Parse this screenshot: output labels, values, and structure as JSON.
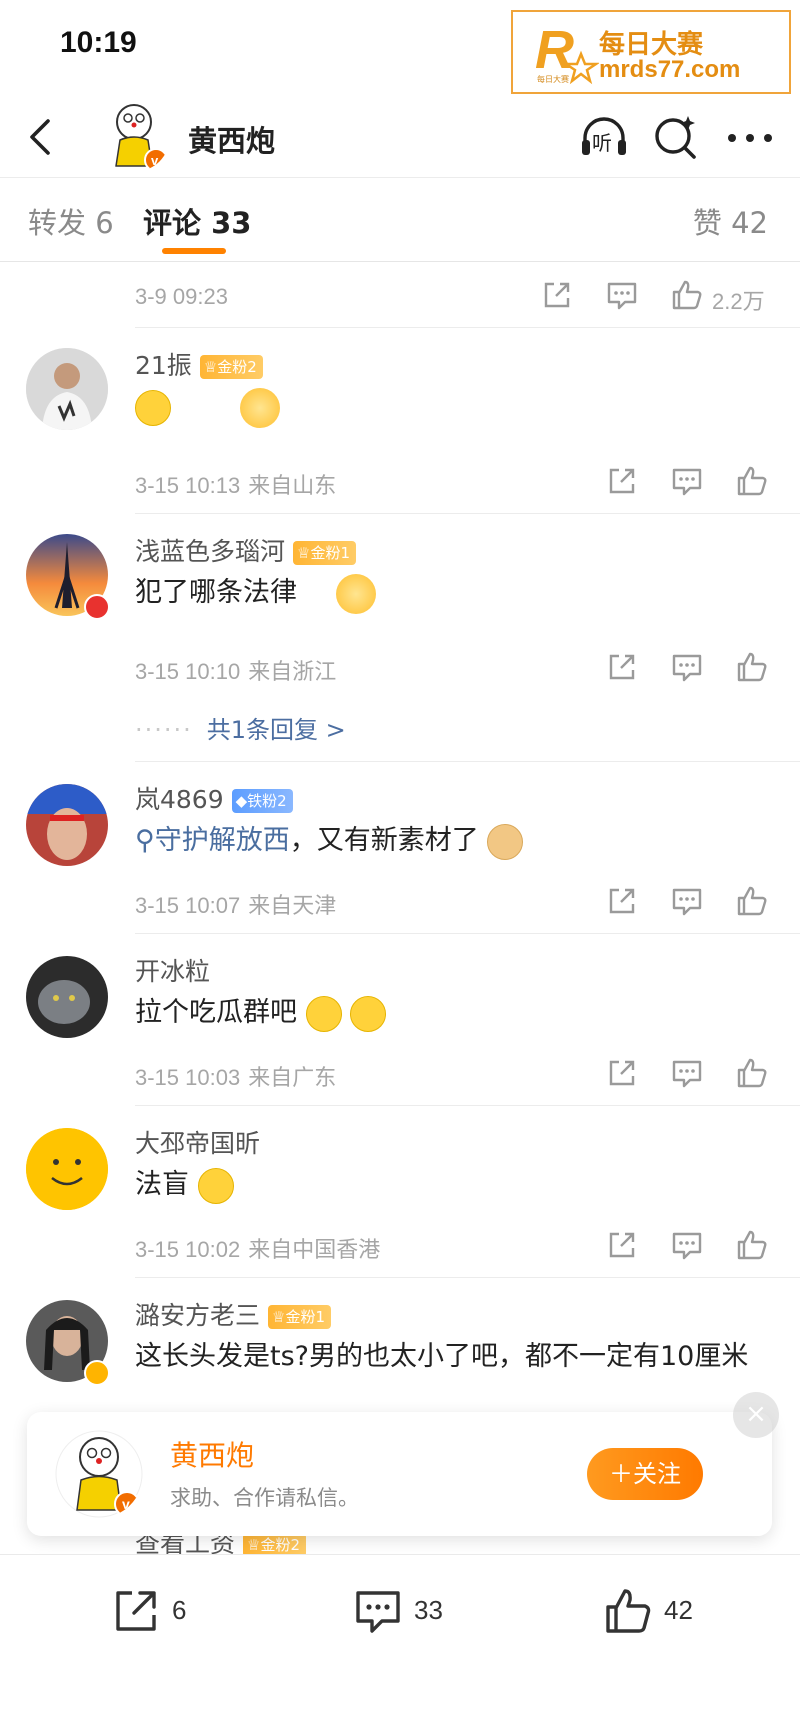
{
  "status_bar": {
    "time": "10:19"
  },
  "watermark": {
    "line1": "每日大赛",
    "line2": "mrds77.com",
    "logo_letter": "R",
    "logo_subtext": "每日大赛"
  },
  "nav": {
    "title": "黄西炮",
    "listen_label": "听"
  },
  "tabs": {
    "repost": "转发 6",
    "comments": "评论 33",
    "likes": "赞 42"
  },
  "first_row": {
    "time": "3-9 09:23",
    "like_count": "2.2万"
  },
  "comments": [
    {
      "name": "21振",
      "badge": "金粉2",
      "text": "",
      "time": "3-15 10:13",
      "location": "来自山东"
    },
    {
      "name": "浅蓝色多瑙河",
      "badge": "金粉1",
      "text": "犯了哪条法律",
      "time": "3-15 10:10",
      "location": "来自浙江",
      "reply": "共1条回复 >",
      "reply_dots": "······"
    },
    {
      "name": "岚4869",
      "badge": "铁粉2",
      "link": "守护解放西",
      "text": "，又有新素材了",
      "time": "3-15 10:07",
      "location": "来自天津"
    },
    {
      "name": "开冰粒",
      "text": "拉个吃瓜群吧",
      "time": "3-15 10:03",
      "location": "来自广东"
    },
    {
      "name": "大邳帝国昕",
      "text": "法盲",
      "time": "3-15 10:02",
      "location": "来自中国香港"
    },
    {
      "name": "潞安方老三",
      "badge": "金粉1",
      "text": "这长头发是ts?男的也太小了吧，都不一定有10厘米"
    },
    {
      "name": "查看工资",
      "badge": "金粉2"
    }
  ],
  "popup": {
    "name": "黄西炮",
    "desc": "求助、合作请私信。",
    "follow": "＋关注",
    "close": "×"
  },
  "bottom_bar": {
    "repost_count": "6",
    "comment_count": "33",
    "like_count": "42"
  },
  "colors": {
    "accent": "#ff8200",
    "link": "#4c6ea1",
    "meta": "#a6a6a6"
  }
}
